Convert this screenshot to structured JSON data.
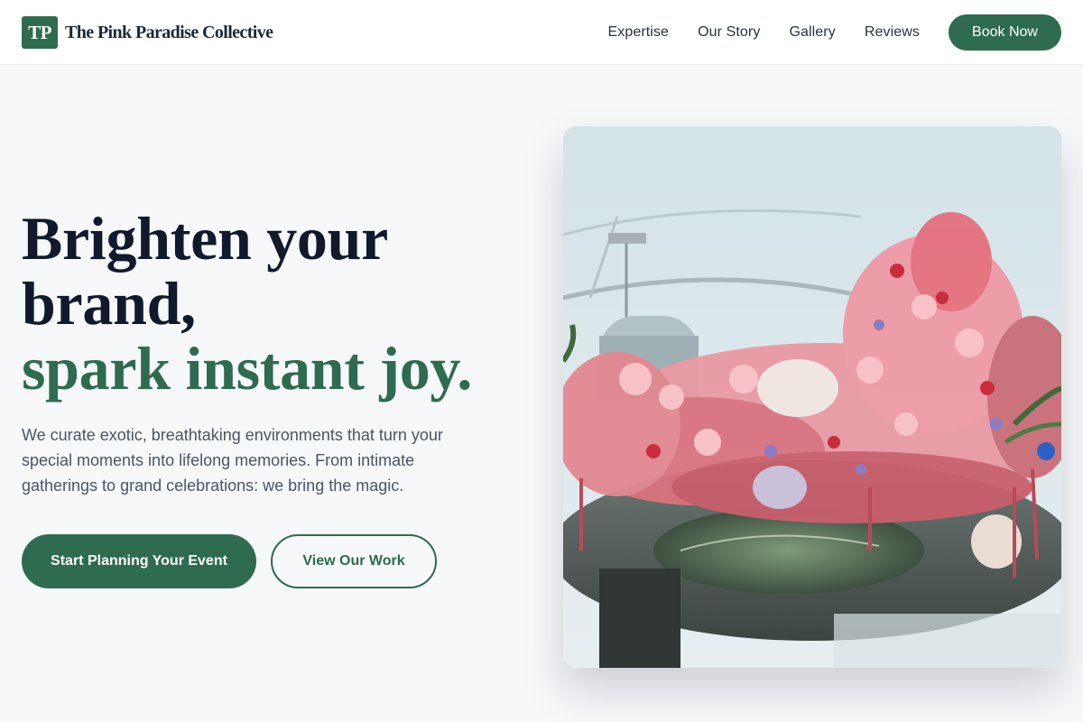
{
  "brand": {
    "logo_text": "TP",
    "name": "The Pink Paradise Collective"
  },
  "nav": {
    "items": [
      {
        "label": "Expertise"
      },
      {
        "label": "Our Story"
      },
      {
        "label": "Gallery"
      },
      {
        "label": "Reviews"
      }
    ],
    "cta_label": "Book Now"
  },
  "hero": {
    "headline_line1": "Brighten your",
    "headline_line2": "brand,",
    "headline_accent": "spark instant joy.",
    "subtext": "We curate exotic, breathtaking environments that turn your special moments into lifelong memories. From intimate gatherings to grand celebrations: we bring the magic.",
    "primary_cta": "Start Planning Your Event",
    "secondary_cta": "View Our Work",
    "image_icon": "floral-installation-photo"
  },
  "colors": {
    "accent": "#2e6b4f",
    "heading": "#101a2c",
    "body_text": "#4a5566",
    "page_background": "#f6f8fa",
    "header_background": "#ffffff"
  }
}
